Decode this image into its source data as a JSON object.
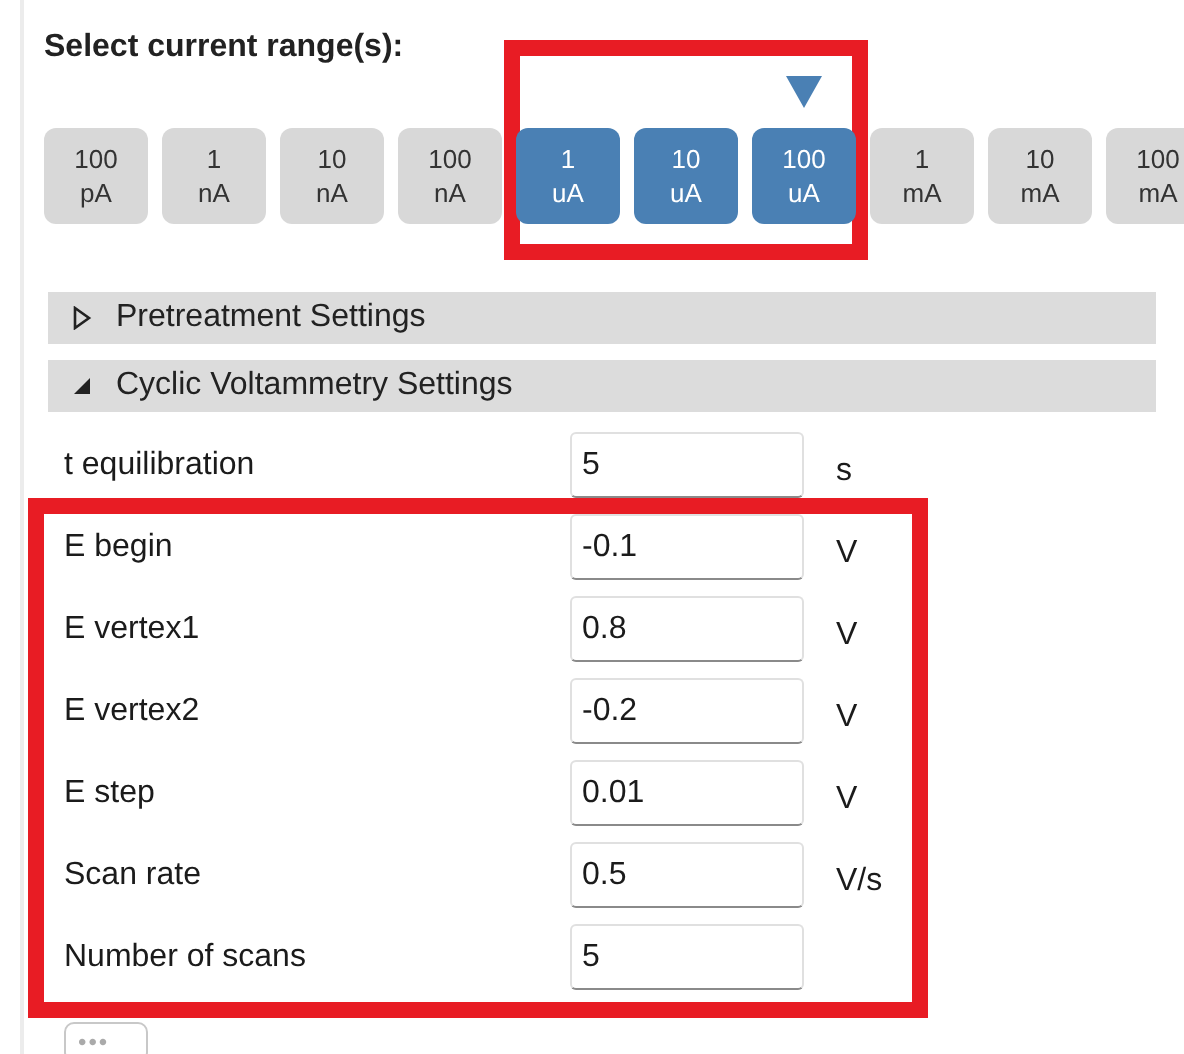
{
  "range_title": "Select current range(s):",
  "range_groups": [
    {
      "highlighted": false,
      "ranges": [
        {
          "value": "100",
          "unit": "pA",
          "selected": false,
          "marker": false
        },
        {
          "value": "1",
          "unit": "nA",
          "selected": false,
          "marker": false
        },
        {
          "value": "10",
          "unit": "nA",
          "selected": false,
          "marker": false
        },
        {
          "value": "100",
          "unit": "nA",
          "selected": false,
          "marker": false
        }
      ]
    },
    {
      "highlighted": true,
      "ranges": [
        {
          "value": "1",
          "unit": "uA",
          "selected": true,
          "marker": false
        },
        {
          "value": "10",
          "unit": "uA",
          "selected": true,
          "marker": false
        },
        {
          "value": "100",
          "unit": "uA",
          "selected": true,
          "marker": true
        }
      ]
    },
    {
      "highlighted": false,
      "ranges": [
        {
          "value": "1",
          "unit": "mA",
          "selected": false,
          "marker": false
        },
        {
          "value": "10",
          "unit": "mA",
          "selected": false,
          "marker": false
        },
        {
          "value": "100",
          "unit": "mA",
          "selected": false,
          "marker": false
        }
      ]
    }
  ],
  "sections": [
    {
      "title": "Pretreatment Settings",
      "expanded": false
    },
    {
      "title": "Cyclic Voltammetry Settings",
      "expanded": true
    }
  ],
  "parameter_groups": [
    {
      "highlighted": false,
      "parameters": [
        {
          "label": "t equilibration",
          "value": "5",
          "unit": "s"
        }
      ]
    },
    {
      "highlighted": true,
      "parameters": [
        {
          "label": "E begin",
          "value": "-0.1",
          "unit": "V"
        },
        {
          "label": "E vertex1",
          "value": "0.8",
          "unit": "V"
        },
        {
          "label": "E vertex2",
          "value": "-0.2",
          "unit": "V"
        },
        {
          "label": "E step",
          "value": "0.01",
          "unit": "V"
        },
        {
          "label": "Scan rate",
          "value": "0.5",
          "unit": "V/s"
        },
        {
          "label": "Number of scans",
          "value": "5"
        }
      ]
    }
  ],
  "more_button": "•••"
}
